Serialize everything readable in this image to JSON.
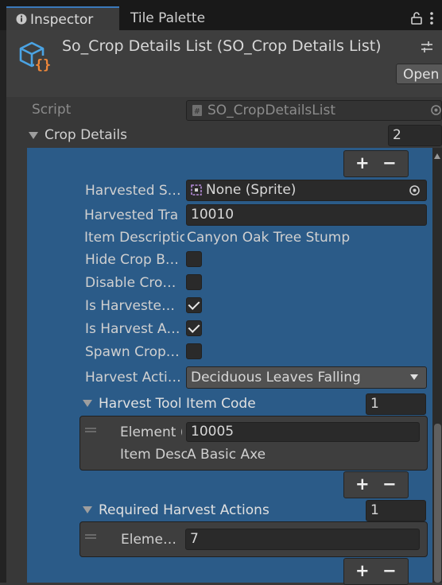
{
  "tabs": {
    "inspector_label": "Inspector",
    "tile_palette_label": "Tile Palette"
  },
  "header": {
    "title": "So_Crop Details List (SO_Crop Details List)",
    "open_label": "Open"
  },
  "script_row": {
    "label": "Script",
    "value": "SO_CropDetailsList"
  },
  "crop_details": {
    "label": "Crop Details",
    "count": "2"
  },
  "fields": {
    "harvested_sprite_label": "Harvested S…",
    "harvested_sprite_value": "None (Sprite)",
    "harvested_transform_label": "Harvested Tra",
    "harvested_transform_value": "10010",
    "item_description_label": "Item Descriptic",
    "item_description_value": "Canyon Oak Tree Stump",
    "hide_crop_label": "Hide Crop B…",
    "disable_crop_label": "Disable Cro…",
    "is_harvested_label": "Is Harveste…",
    "is_harvest_a_label": "Is Harvest A…",
    "spawn_crop_label": "Spawn Crop…",
    "harvest_action_label": "Harvest Acti…",
    "harvest_action_value": "Deciduous Leaves Falling"
  },
  "checkboxes": {
    "hide_crop": false,
    "disable_crop": false,
    "is_harvested": true,
    "is_harvest_a": true,
    "spawn_crop": false
  },
  "harvest_tool": {
    "label": "Harvest Tool Item Code",
    "count": "1",
    "element_label": "Element (",
    "element_value": "10005",
    "desc_label": "Item Desc",
    "desc_value": "A Basic Axe"
  },
  "required_actions": {
    "label": "Required Harvest Actions",
    "count": "1",
    "element_label": "Eleme…",
    "element_value": "7"
  },
  "buttons": {
    "plus": "+",
    "minus": "−"
  },
  "colors": {
    "selected_bg": "#2b5b88",
    "panel_bg": "#383838",
    "tab_accent": "#3a79bb"
  }
}
